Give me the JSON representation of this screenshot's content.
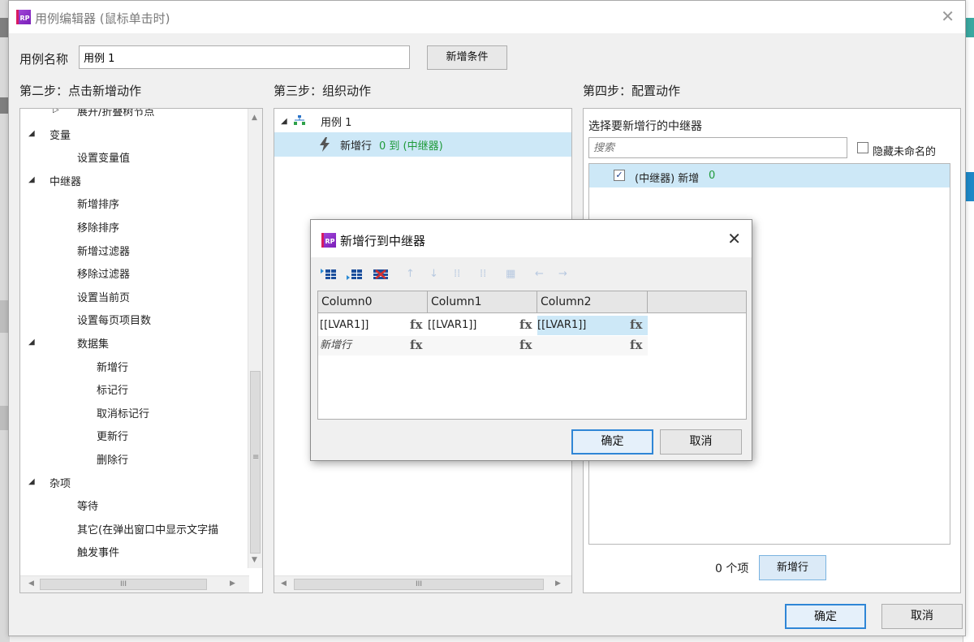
{
  "dialog": {
    "title": "用例编辑器 (鼠标单击时)",
    "logo_text": "RP",
    "close_glyph": "✕",
    "use_case_label": "用例名称",
    "use_case_value": "用例 1",
    "add_condition_label": "新增条件",
    "ok_label": "确定",
    "cancel_label": "取消"
  },
  "step2": {
    "title": "第二步：点击新增动作",
    "items": [
      {
        "label": "展开/折叠树节点",
        "level": 1,
        "expander": "▷"
      },
      {
        "label": "变量",
        "level": 0,
        "expander": "◢"
      },
      {
        "label": "设置变量值",
        "level": 1,
        "expander": ""
      },
      {
        "label": "中继器",
        "level": 0,
        "expander": "◢"
      },
      {
        "label": "新增排序",
        "level": 1,
        "expander": ""
      },
      {
        "label": "移除排序",
        "level": 1,
        "expander": ""
      },
      {
        "label": "新增过滤器",
        "level": 1,
        "expander": ""
      },
      {
        "label": "移除过滤器",
        "level": 1,
        "expander": ""
      },
      {
        "label": "设置当前页",
        "level": 1,
        "expander": ""
      },
      {
        "label": "设置每页项目数",
        "level": 1,
        "expander": ""
      },
      {
        "label": "数据集",
        "level": 1,
        "expander": "◢"
      },
      {
        "label": "新增行",
        "level": 2,
        "expander": ""
      },
      {
        "label": "标记行",
        "level": 2,
        "expander": ""
      },
      {
        "label": "取消标记行",
        "level": 2,
        "expander": ""
      },
      {
        "label": "更新行",
        "level": 2,
        "expander": ""
      },
      {
        "label": "删除行",
        "level": 2,
        "expander": ""
      },
      {
        "label": "杂项",
        "level": 0,
        "expander": "◢"
      },
      {
        "label": "等待",
        "level": 1,
        "expander": ""
      },
      {
        "label": "其它(在弹出窗口中显示文字描",
        "level": 1,
        "expander": ""
      },
      {
        "label": "触发事件",
        "level": 1,
        "expander": ""
      }
    ]
  },
  "step3": {
    "title": "第三步：组织动作",
    "case_label": "用例 1",
    "action_prefix": "新增行",
    "action_detail": "0 到 (中继器)"
  },
  "step4": {
    "title": "第四步：配置动作",
    "select_label": "选择要新增行的中继器",
    "search_placeholder": "搜索",
    "hide_unnamed_label": "隐藏未命名的",
    "repeater_label": "(中继器) 新增",
    "repeater_count": "0",
    "count_label": "0 个项",
    "add_row_label": "新增行"
  },
  "modal": {
    "title": "新增行到中继器",
    "logo_text": "RP",
    "close_glyph": "✕",
    "columns": [
      "Column0",
      "Column1",
      "Column2"
    ],
    "rows": [
      [
        "[[LVAR1]]",
        "[[LVAR1]]",
        "[[LVAR1]]"
      ]
    ],
    "new_row_placeholder": "新增行",
    "fx_label": "fx",
    "ok_label": "确定",
    "cancel_label": "取消"
  },
  "scroll": {
    "thumb_grip": "III",
    "grip_v": "≡"
  },
  "colors": {
    "accent": "#2f86d6",
    "selection": "#cde8f7",
    "green_text": "#1f9a3a"
  }
}
